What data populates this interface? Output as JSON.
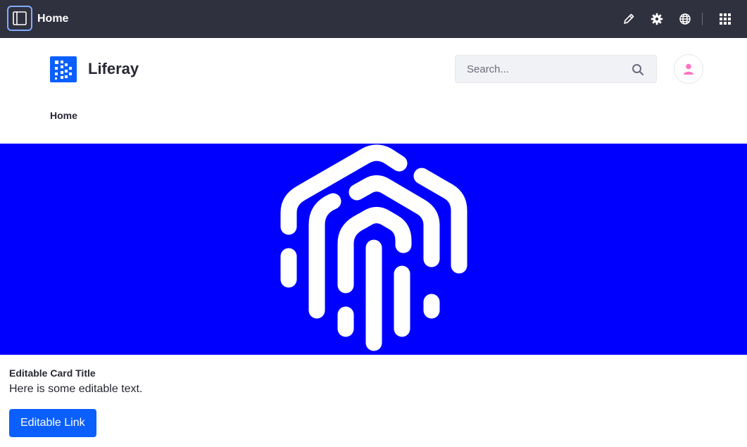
{
  "control_menu": {
    "page_title": "Home",
    "icons": [
      "panel-toggle-icon",
      "edit-icon",
      "settings-icon",
      "globe-icon",
      "apps-grid-icon"
    ]
  },
  "header": {
    "site_name": "Liferay",
    "search": {
      "placeholder": "Search...",
      "value": ""
    },
    "avatar_color": "#ff73c3"
  },
  "breadcrumb": {
    "current": "Home"
  },
  "banner": {
    "background": "#0000ff",
    "image": "fingerprint-icon"
  },
  "card": {
    "title": "Editable Card Title",
    "text": "Here is some editable text.",
    "link_label": "Editable Link"
  },
  "colors": {
    "accent": "#0b5fff",
    "control_menu": "#30313f",
    "logo": "#0b5fff"
  }
}
